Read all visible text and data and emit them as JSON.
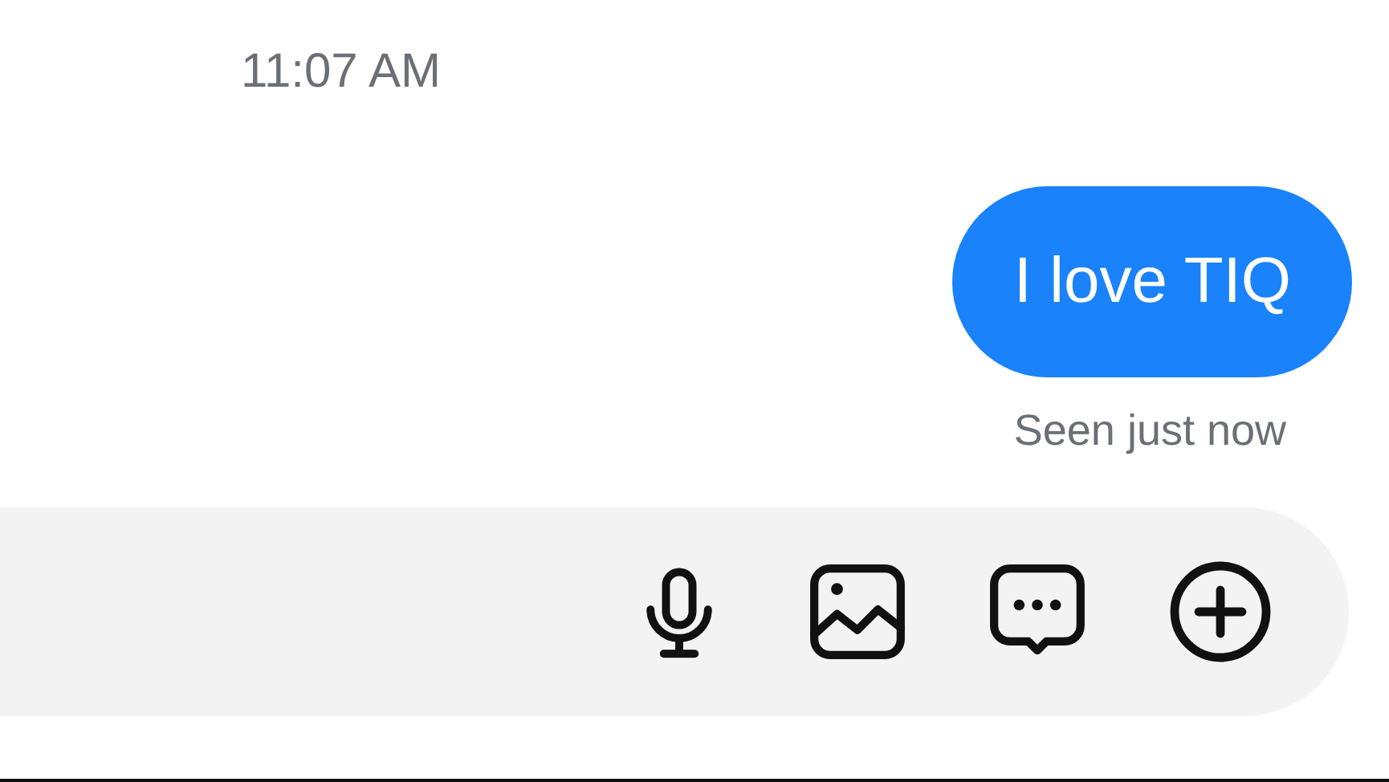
{
  "timestamp": "11:07 AM",
  "messages": [
    {
      "text": "I love TIQ",
      "outgoing": true
    }
  ],
  "receipt": "Seen just now"
}
